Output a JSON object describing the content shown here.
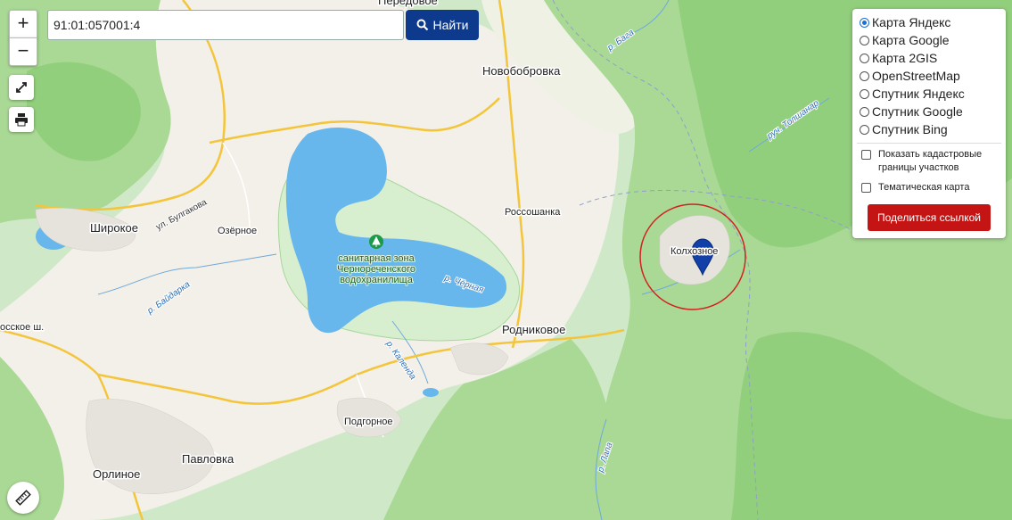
{
  "search": {
    "value": "91:01:057001:4",
    "button_label": "Найти"
  },
  "controls": {
    "zoom_in": "+",
    "zoom_out": "−"
  },
  "layers": {
    "options": [
      {
        "label": "Карта Яндекс",
        "selected": true
      },
      {
        "label": "Карта Google",
        "selected": false
      },
      {
        "label": "Карта 2GIS",
        "selected": false
      },
      {
        "label": "OpenStreetMap",
        "selected": false
      },
      {
        "label": "Спутник Яндекс",
        "selected": false
      },
      {
        "label": "Спутник Google",
        "selected": false
      },
      {
        "label": "Спутник Bing",
        "selected": false
      }
    ],
    "show_cadastral_label": "Показать кадастровые границы участков",
    "show_cadastral_line1": "Показать кадастровые",
    "show_cadastral_line2": "границы участков",
    "thematic_label": "Тематическая карта",
    "share_label": "Поделиться ссылкой"
  },
  "map": {
    "places": {
      "peredovoe": "Передовое",
      "novobobrovka": "Новобобровка",
      "shirokoe": "Широкое",
      "ozernoe": "Озёрное",
      "rossoshanka": "Россошанка",
      "kolkhoznoe": "Колхозное",
      "rodnikovoe": "Родниковое",
      "podgornoe": "Подгорное",
      "pavlovka": "Павловка",
      "orlinoe": "Орлиное",
      "rosskoe": "осское ш."
    },
    "streets": {
      "bulgakova": "ул. Булгакова"
    },
    "rivers": {
      "baga": "р. Бага",
      "tolshanar": "руч. Толшанар",
      "baydarka": "р. Байдарка",
      "chernaya": "р. Чёрная",
      "kalenda": "р. Календа",
      "lapa": "р. Лапа"
    },
    "park": {
      "line1": "санитарная зона",
      "line2": "Чернореченского",
      "line3": "водохранилища"
    },
    "colors": {
      "forest": "#a8d98f",
      "water": "#67b7ec",
      "marker": "#1140a8",
      "circle": "#d32020",
      "share_button": "#c41414",
      "search_button": "#0d3a8c"
    }
  }
}
